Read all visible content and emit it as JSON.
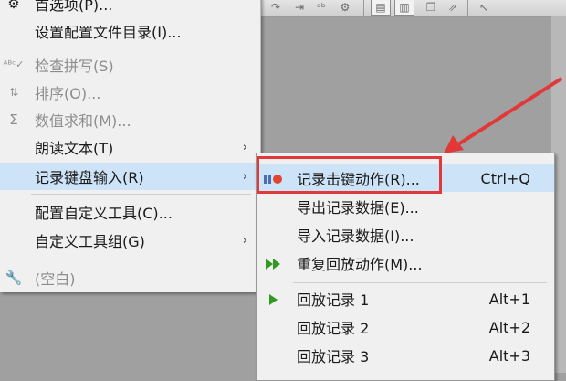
{
  "main_menu": {
    "items": [
      {
        "label": "首选项(P)...",
        "icon": "preferences-icon",
        "disabled": false
      },
      {
        "label": "设置配置文件目录(I)...",
        "icon": "",
        "disabled": false
      },
      {
        "label": "检查拼写(S)",
        "icon": "spellcheck-icon",
        "disabled": true
      },
      {
        "label": "排序(O)...",
        "icon": "sort-icon",
        "disabled": true
      },
      {
        "label": "数值求和(M)...",
        "icon": "sigma-icon",
        "disabled": true
      },
      {
        "label": "朗读文本(T)",
        "icon": "",
        "disabled": false,
        "submenu": true
      },
      {
        "label": "记录键盘输入(R)",
        "icon": "",
        "disabled": false,
        "submenu": true,
        "highlighted": true
      },
      {
        "label": "配置自定义工具(C)...",
        "icon": "",
        "disabled": false
      },
      {
        "label": "自定义工具组(G)",
        "icon": "",
        "disabled": false,
        "submenu": true
      },
      {
        "label": "(空白)",
        "icon": "wrench-icon",
        "disabled": true
      }
    ]
  },
  "submenu": {
    "items": [
      {
        "label": "记录击键动作(R)...",
        "shortcut": "Ctrl+Q",
        "icon": "pause-record-icon",
        "highlighted": true
      },
      {
        "label": "导出记录数据(E)...",
        "shortcut": "",
        "icon": ""
      },
      {
        "label": "导入记录数据(I)...",
        "shortcut": "",
        "icon": ""
      },
      {
        "label": "重复回放动作(M)...",
        "shortcut": "",
        "icon": "fast-forward-icon"
      },
      {
        "label": "回放记录 1",
        "shortcut": "Alt+1",
        "icon": "play-icon"
      },
      {
        "label": "回放记录 2",
        "shortcut": "Alt+2",
        "icon": ""
      },
      {
        "label": "回放记录 3",
        "shortcut": "Alt+3",
        "icon": ""
      }
    ]
  },
  "colors": {
    "highlight": "#cde3f7",
    "annotation": "#e23838",
    "play_icon": "#2f9a1f"
  }
}
